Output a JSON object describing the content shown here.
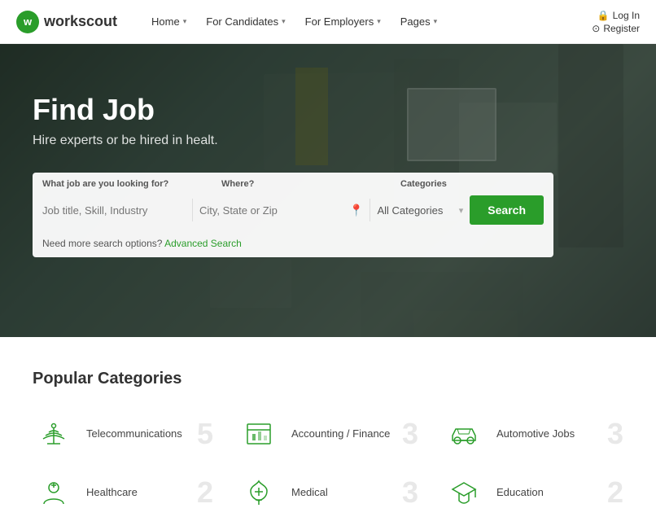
{
  "navbar": {
    "logo_initial": "w",
    "logo_name": "workscout",
    "nav_items": [
      {
        "label": "Home",
        "has_dropdown": true
      },
      {
        "label": "For Candidates",
        "has_dropdown": true
      },
      {
        "label": "For Employers",
        "has_dropdown": true
      },
      {
        "label": "Pages",
        "has_dropdown": true
      }
    ],
    "auth_items": [
      {
        "label": "Log In",
        "icon": "lock"
      },
      {
        "label": "Register",
        "icon": "circle"
      }
    ]
  },
  "hero": {
    "title": "Find Job",
    "subtitle": "Hire experts or be hired in healt.",
    "search": {
      "label_job": "What job are you looking for?",
      "label_where": "Where?",
      "label_category": "Categories",
      "placeholder_job": "Job title, Skill, Industry",
      "placeholder_where": "City, State or Zip",
      "placeholder_category": "All Categories",
      "search_button": "Search",
      "advanced_text": "Need more search options?",
      "advanced_link": "Advanced Search"
    }
  },
  "categories_section": {
    "title": "Popular Categories",
    "categories": [
      {
        "name": "Telecommunications",
        "count": "5",
        "icon": "telecom"
      },
      {
        "name": "Accounting / Finance",
        "count": "3",
        "icon": "accounting"
      },
      {
        "name": "Automotive Jobs",
        "count": "3",
        "icon": "automotive"
      },
      {
        "name": "Healthcare",
        "count": "2",
        "icon": "healthcare"
      },
      {
        "name": "Medical",
        "count": "3",
        "icon": "medical"
      },
      {
        "name": "Education",
        "count": "2",
        "icon": "education"
      }
    ]
  }
}
